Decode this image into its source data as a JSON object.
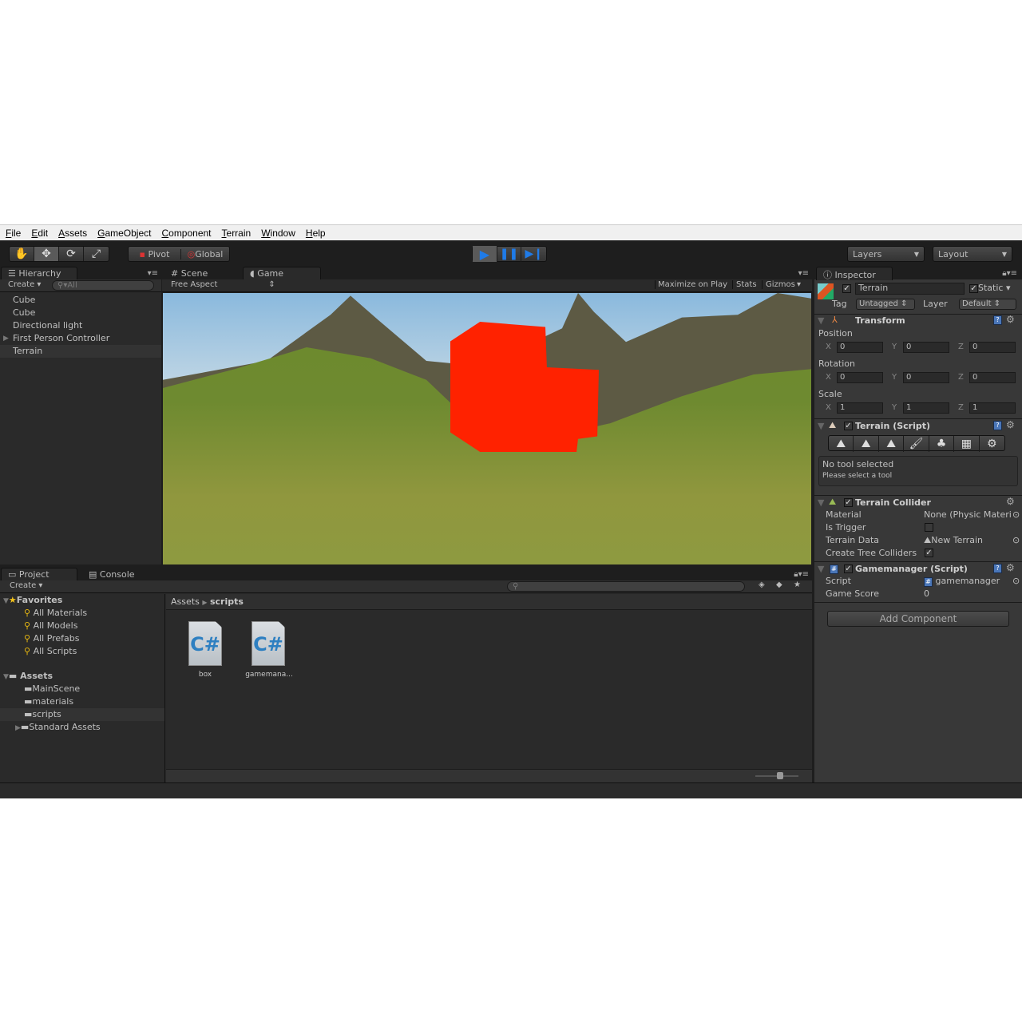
{
  "menu": [
    "File",
    "Edit",
    "Assets",
    "GameObject",
    "Component",
    "Terrain",
    "Window",
    "Help"
  ],
  "toolbar": {
    "tools": [
      "hand-icon",
      "move-icon",
      "rotate-icon",
      "scale-icon"
    ],
    "pivot_label": "Pivot",
    "global_label": "Global",
    "play": [
      "play-icon",
      "pause-icon",
      "step-icon"
    ],
    "layers_label": "Layers",
    "layout_label": "Layout",
    "accent": "#1f7be8"
  },
  "hierarchy": {
    "tab": "Hierarchy",
    "create": "Create",
    "search_placeholder": "All",
    "items": [
      "Cube",
      "Cube",
      "Directional light",
      "First Person Controller",
      "Terrain"
    ],
    "selected": "Terrain"
  },
  "game": {
    "tabs": [
      "Scene",
      "Game"
    ],
    "aspect": "Free Aspect",
    "maximize": "Maximize on Play",
    "stats": "Stats",
    "gizmos": "Gizmos",
    "cube_color": "#ff2200"
  },
  "inspector": {
    "tab": "Inspector",
    "object_name": "Terrain",
    "static_label": "Static",
    "tag_label": "Tag",
    "tag_value": "Untagged",
    "layer_label": "Layer",
    "layer_value": "Default",
    "transform": {
      "title": "Transform",
      "position_label": "Position",
      "rotation_label": "Rotation",
      "scale_label": "Scale",
      "axes": [
        "X",
        "Y",
        "Z"
      ],
      "position": [
        "0",
        "0",
        "0"
      ],
      "rotation": [
        "0",
        "0",
        "0"
      ],
      "scale": [
        "1",
        "1",
        "1"
      ]
    },
    "terrain_script": {
      "title": "Terrain (Script)",
      "msg1": "No tool selected",
      "msg2": "Please select a tool"
    },
    "terrain_collider": {
      "title": "Terrain Collider",
      "material_label": "Material",
      "material_value": "None (Physic Materi",
      "trigger_label": "Is Trigger",
      "trigger_checked": false,
      "data_label": "Terrain Data",
      "data_value": "New Terrain",
      "trees_label": "Create Tree Colliders",
      "trees_checked": true
    },
    "gamemanager": {
      "title": "Gamemanager (Script)",
      "script_label": "Script",
      "script_value": "gamemanager",
      "score_label": "Game Score",
      "score_value": "0"
    },
    "add_component": "Add Component"
  },
  "project": {
    "tabs": [
      "Project",
      "Console"
    ],
    "create": "Create",
    "favorites_label": "Favorites",
    "favorites": [
      "All Materials",
      "All Models",
      "All Prefabs",
      "All Scripts"
    ],
    "assets_label": "Assets",
    "folders": [
      "MainScene",
      "materials",
      "scripts",
      "Standard Assets"
    ],
    "selected_folder": "scripts",
    "breadcrumb": [
      "Assets",
      "scripts"
    ],
    "files": [
      "box",
      "gamemana..."
    ],
    "file_icon_text": "C#"
  }
}
